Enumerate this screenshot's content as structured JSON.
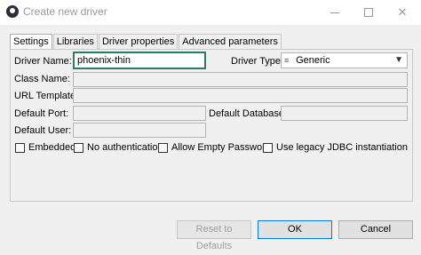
{
  "window": {
    "title": "Create new driver",
    "min_icon": "minimize-icon",
    "max_icon": "maximize-icon",
    "close_glyph": "✕"
  },
  "tabs": [
    {
      "label": "Settings",
      "active": true
    },
    {
      "label": "Libraries",
      "active": false
    },
    {
      "label": "Driver properties",
      "active": false
    },
    {
      "label": "Advanced parameters",
      "active": false
    }
  ],
  "form": {
    "driver_name_label": "Driver Name:",
    "driver_name_value": "phoenix-thin",
    "driver_type_label": "Driver Type:",
    "driver_type_value": "Generic",
    "driver_type_icon_glyph": "≡",
    "dropdown_glyph": "▼",
    "class_name_label": "Class Name:",
    "url_template_label": "URL Template:",
    "default_port_label": "Default Port:",
    "default_database_label": "Default Database:",
    "default_user_label": "Default User:"
  },
  "checkboxes": [
    {
      "label": "Embedded",
      "checked": false
    },
    {
      "label": "No authentication",
      "checked": false
    },
    {
      "label": "Allow Empty Password",
      "checked": false
    },
    {
      "label": "Use legacy JDBC instantiation",
      "checked": false
    }
  ],
  "buttons": {
    "reset": "Reset to Defaults",
    "ok": "OK",
    "cancel": "Cancel"
  },
  "colors": {
    "focus_border": "#2e7d62",
    "primary_border": "#0078d7"
  }
}
